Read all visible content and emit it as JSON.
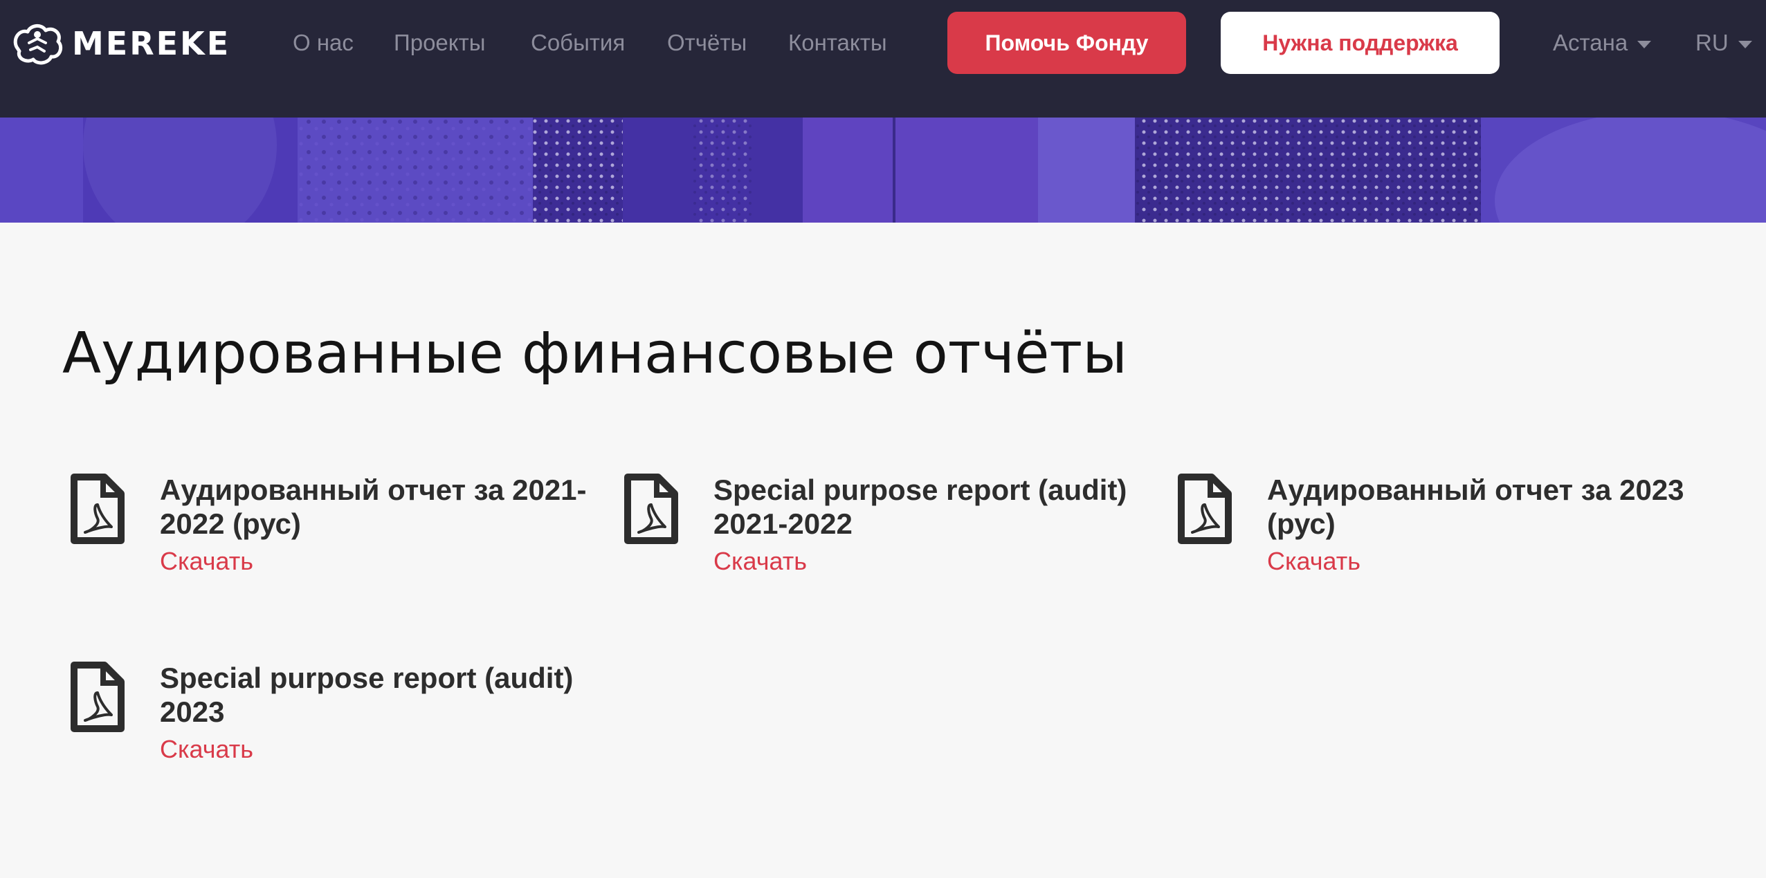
{
  "header": {
    "logo_text": "MEREKE",
    "nav": [
      {
        "label": "О нас"
      },
      {
        "label": "Проекты"
      },
      {
        "label": "События"
      },
      {
        "label": "Отчёты"
      },
      {
        "label": "Контакты"
      }
    ],
    "donate_button": "Помочь Фонду",
    "help_button": "Нужна поддержка",
    "city": "Астана",
    "language": "RU"
  },
  "colors": {
    "header_bg": "#262639",
    "accent": "#d93a49",
    "banner": "#4d39b4",
    "page_bg": "#f7f7f7"
  },
  "main": {
    "title": "Аудированные финансовые отчёты",
    "reports": [
      {
        "title": "Аудированный отчет за 2021-2022 (рус)",
        "action": "Скачать",
        "icon": "pdf-file-icon"
      },
      {
        "title": "Special purpose report (audit) 2021-2022",
        "action": "Скачать",
        "icon": "pdf-file-icon"
      },
      {
        "title": "Аудированный отчет за 2023 (рус)",
        "action": "Скачать",
        "icon": "pdf-file-icon"
      },
      {
        "title": "Special purpose report (audit) 2023",
        "action": "Скачать",
        "icon": "pdf-file-icon"
      }
    ]
  }
}
